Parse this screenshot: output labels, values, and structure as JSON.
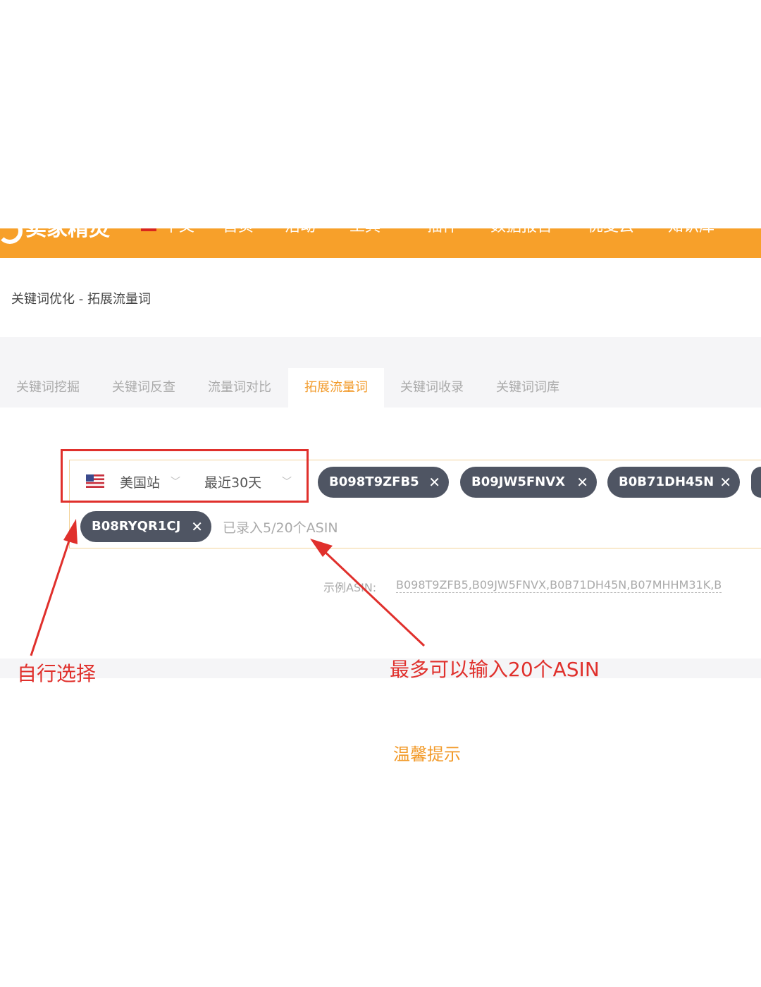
{
  "header": {
    "brand": "卖家精灵",
    "nav": [
      "中文",
      "首页",
      "活动",
      "工具",
      "插件",
      "数据报告",
      "优麦云",
      "知识库"
    ]
  },
  "breadcrumb": "关键词优化 - 拓展流量词",
  "tabs": [
    {
      "label": "关键词挖掘",
      "active": false
    },
    {
      "label": "关键词反查",
      "active": false
    },
    {
      "label": "流量词对比",
      "active": false
    },
    {
      "label": "拓展流量词",
      "active": true
    },
    {
      "label": "关键词收录",
      "active": false
    },
    {
      "label": "关键词词库",
      "active": false
    }
  ],
  "selector": {
    "site": "美国站",
    "range": "最近30天"
  },
  "asin_chips": [
    "B098T9ZFB5",
    "B09JW5FNVX",
    "B0B71DH45N",
    "B08RYQR1CJ"
  ],
  "counter_text": "已录入5/20个ASIN",
  "example": {
    "label": "示例ASIN:",
    "value": "B098T9ZFB5,B09JW5FNVX,B0B71DH45N,B07MHHM31K,B"
  },
  "annotations": {
    "left": "自行选择",
    "right": "最多可以输入20个ASIN"
  },
  "tips_title": "温馨提示",
  "colors": {
    "brand_orange": "#f7a02a",
    "accent_orange": "#f29a29",
    "chip_bg": "#4f5563",
    "annotation_red": "#e0302c"
  }
}
